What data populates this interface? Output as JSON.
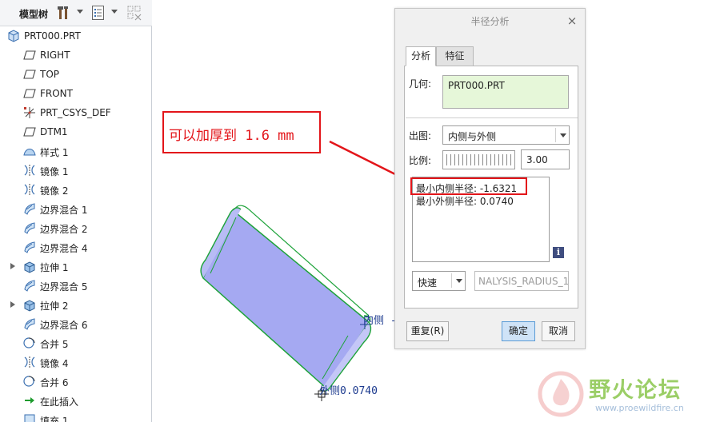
{
  "tree": {
    "title": "模型树",
    "items": [
      {
        "label": "PRT000.PRT",
        "icon": "part-icon",
        "level": "root",
        "expandable": false
      },
      {
        "label": "RIGHT",
        "icon": "datum-plane-icon",
        "level": "child",
        "expandable": false
      },
      {
        "label": "TOP",
        "icon": "datum-plane-icon",
        "level": "child",
        "expandable": false
      },
      {
        "label": "FRONT",
        "icon": "datum-plane-icon",
        "level": "child",
        "expandable": false
      },
      {
        "label": "PRT_CSYS_DEF",
        "icon": "csys-icon",
        "level": "child",
        "expandable": false
      },
      {
        "label": "DTM1",
        "icon": "datum-plane-icon",
        "level": "child",
        "expandable": false
      },
      {
        "label": "样式 1",
        "icon": "style-surface-icon",
        "level": "child",
        "expandable": false
      },
      {
        "label": "镜像 1",
        "icon": "mirror-icon",
        "level": "child",
        "expandable": false
      },
      {
        "label": "镜像 2",
        "icon": "mirror-icon",
        "level": "child",
        "expandable": false
      },
      {
        "label": "边界混合 1",
        "icon": "boundary-blend-icon",
        "level": "child",
        "expandable": false
      },
      {
        "label": "边界混合 2",
        "icon": "boundary-blend-icon",
        "level": "child",
        "expandable": false
      },
      {
        "label": "边界混合 4",
        "icon": "boundary-blend-icon",
        "level": "child",
        "expandable": false
      },
      {
        "label": "拉伸 1",
        "icon": "extrude-icon",
        "level": "child",
        "expandable": true
      },
      {
        "label": "边界混合 5",
        "icon": "boundary-blend-icon",
        "level": "child",
        "expandable": false
      },
      {
        "label": "拉伸 2",
        "icon": "extrude-icon",
        "level": "child",
        "expandable": true
      },
      {
        "label": "边界混合 6",
        "icon": "boundary-blend-icon",
        "level": "child",
        "expandable": false
      },
      {
        "label": "合并 5",
        "icon": "merge-icon",
        "level": "child",
        "expandable": false
      },
      {
        "label": "镜像 4",
        "icon": "mirror-icon",
        "level": "child",
        "expandable": false
      },
      {
        "label": "合并 6",
        "icon": "merge-icon",
        "level": "child",
        "expandable": false
      },
      {
        "label": "在此插入",
        "icon": "insert-here-arrow-icon",
        "level": "child",
        "expandable": false
      },
      {
        "label": "填充 1",
        "icon": "fill-icon",
        "level": "child",
        "expandable": false
      }
    ]
  },
  "viewport": {
    "dim_inner": "内侧 - |",
    "dim_outer": "外侧0.0740"
  },
  "annotation": {
    "text": "可以加厚到 1.6 mm",
    "color": "#e3151a"
  },
  "dialog": {
    "title": "半径分析",
    "close": "×",
    "tabs": {
      "analysis": "分析",
      "feature": "特征"
    },
    "geometry_label": "几何:",
    "geometry_value": "PRT000.PRT",
    "output_label": "出图:",
    "output_value": "内侧与外侧",
    "scale_label": "比例:",
    "scale_value": "3.00",
    "result_min_inner": "最小内侧半径: -1.6321",
    "result_min_outer": "最小外侧半径: 0.0740",
    "info": "i",
    "quick_value": "快速",
    "name_value": "NALYSIS_RADIUS_1",
    "buttons": {
      "repeat": "重复(R)",
      "ok": "确定",
      "cancel": "取消"
    }
  },
  "watermark": {
    "title": "野火论坛",
    "url": "www.proewildfire.cn"
  },
  "colors": {
    "model_fill": "#a5a9f2",
    "model_edge": "#1ea33a",
    "geometry_bg": "#e6f7d9",
    "highlight": "#e3151a"
  }
}
